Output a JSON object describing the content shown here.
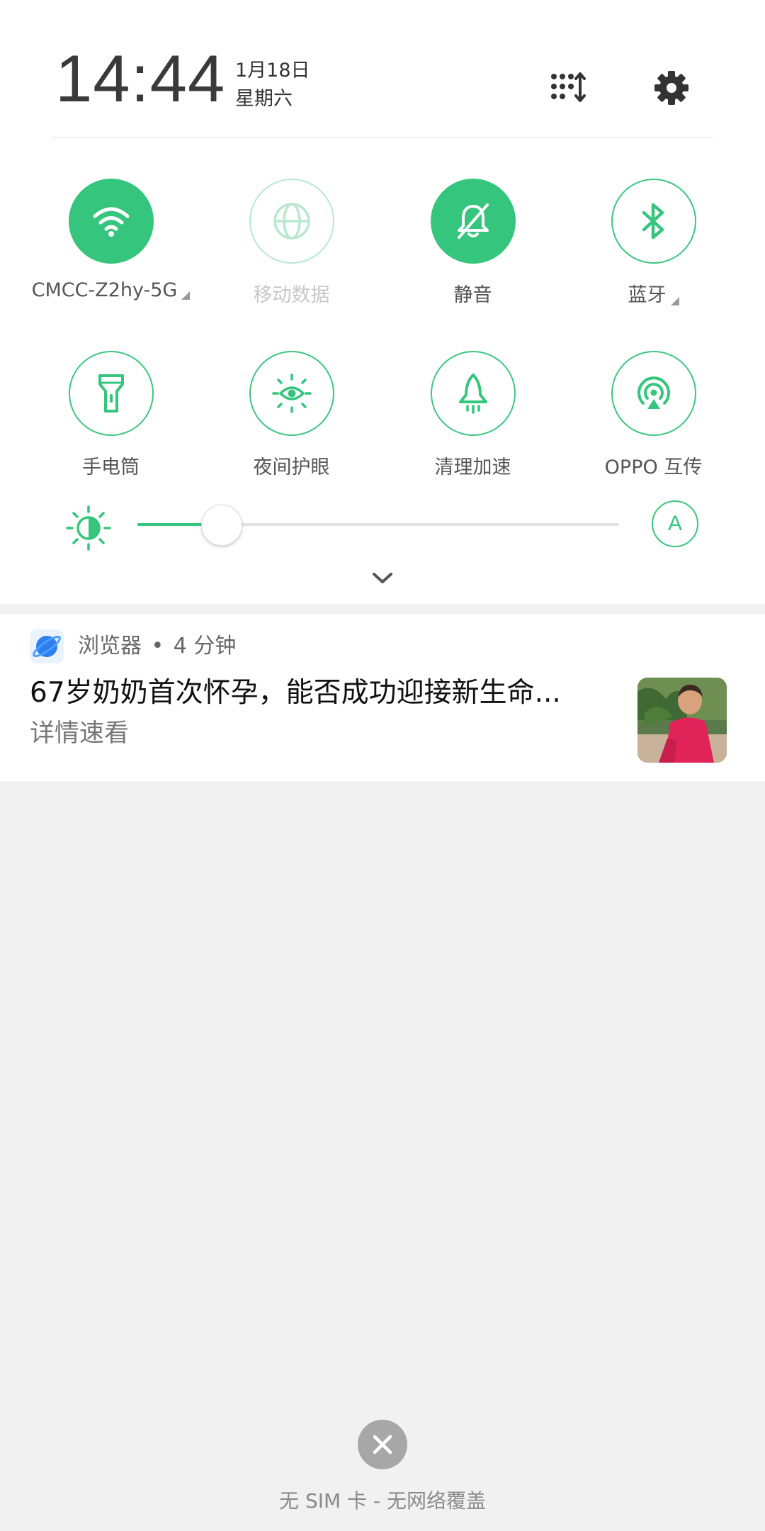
{
  "header": {
    "time": "14:44",
    "date": "1月18日",
    "weekday": "星期六",
    "edit_icon": "grid-sort-icon",
    "settings_icon": "gear-icon"
  },
  "quick_settings": [
    {
      "label": "CMCC-Z2hy-5G",
      "icon": "wifi-icon",
      "state": "on",
      "expandable": true
    },
    {
      "label": "移动数据",
      "icon": "globe-icon",
      "state": "disabled",
      "expandable": false
    },
    {
      "label": "静音",
      "icon": "bell-off-icon",
      "state": "on",
      "expandable": false
    },
    {
      "label": "蓝牙",
      "icon": "bluetooth-icon",
      "state": "off",
      "expandable": true
    },
    {
      "label": "手电筒",
      "icon": "flashlight-icon",
      "state": "off"
    },
    {
      "label": "夜间护眼",
      "icon": "eye-sun-icon",
      "state": "off"
    },
    {
      "label": "清理加速",
      "icon": "rocket-icon",
      "state": "off"
    },
    {
      "label": "OPPO 互传",
      "icon": "share-signal-icon",
      "state": "off"
    }
  ],
  "brightness": {
    "level": 0.16,
    "auto_label": "A"
  },
  "notification": {
    "app_name": "浏览器",
    "separator": "•",
    "time": "4 分钟",
    "title": "67岁奶奶首次怀孕，能否成功迎接新生命...",
    "body": "详情速看"
  },
  "footer": {
    "status": "无 SIM 卡 - 无网络覆盖"
  },
  "colors": {
    "accent": "#35c57d",
    "panel": "#ffffff",
    "background": "#f1f1f1"
  }
}
